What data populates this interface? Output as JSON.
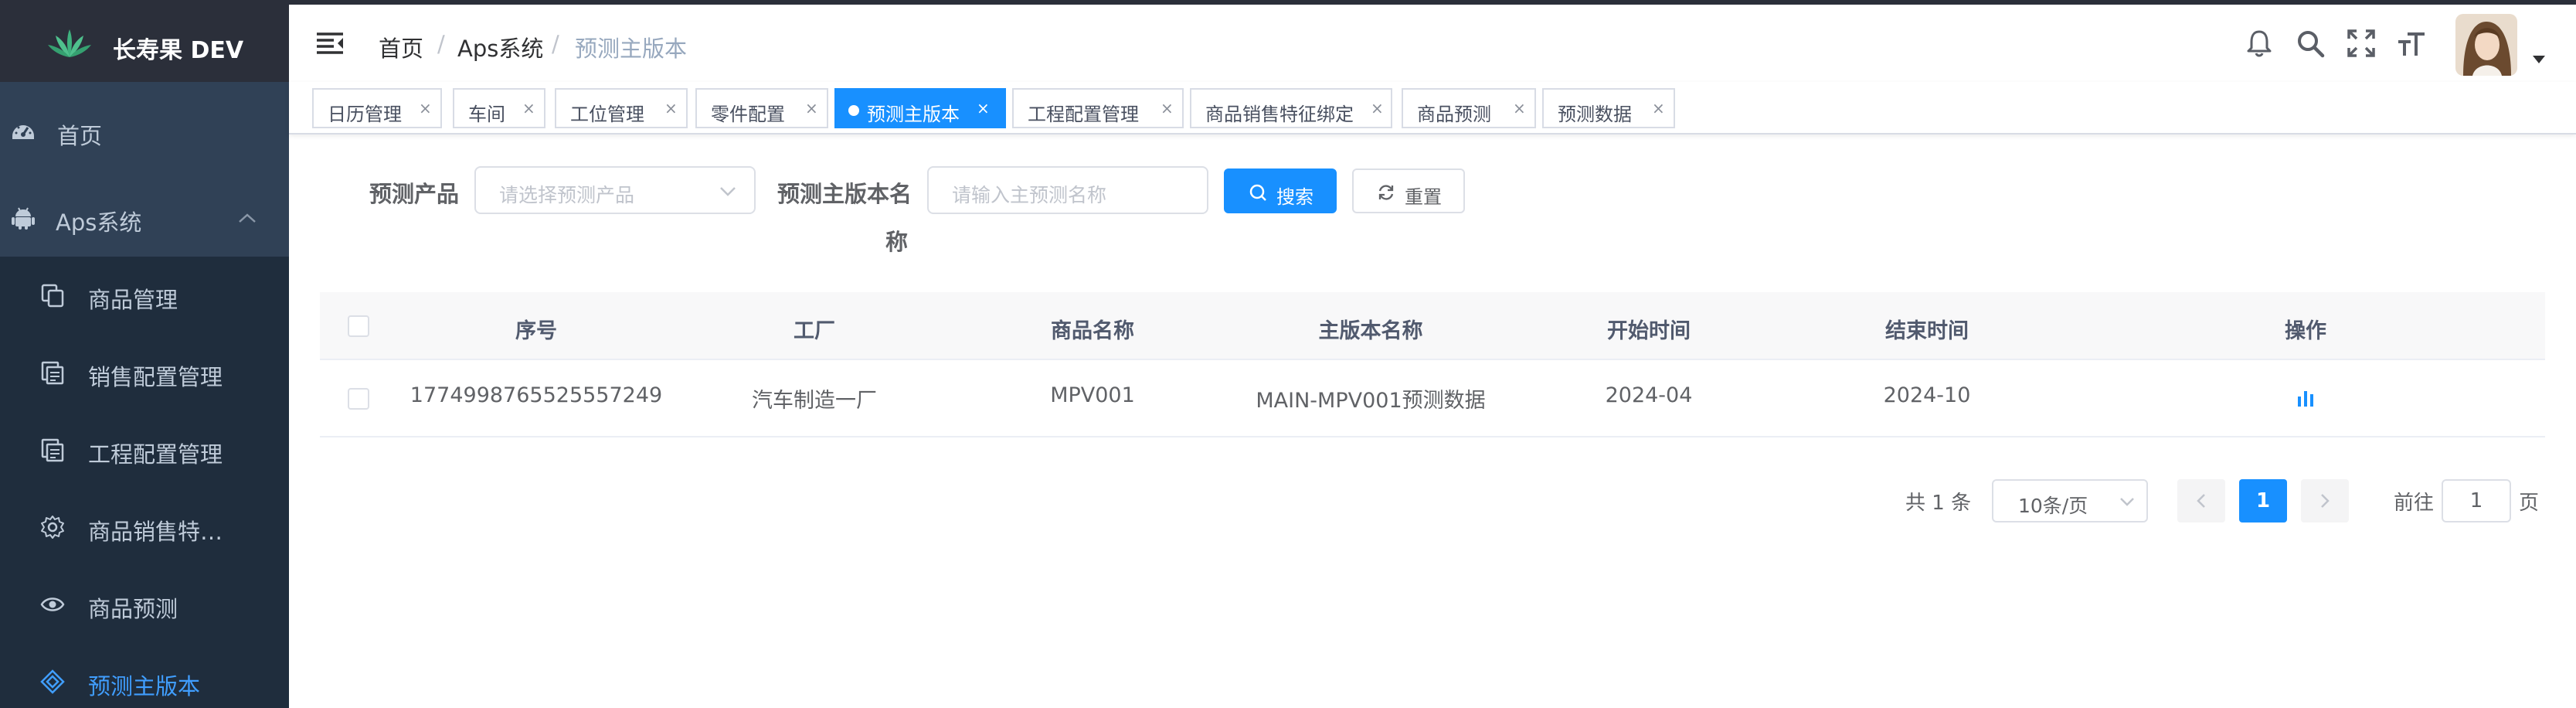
{
  "colors": {
    "sidebar_bg": "#304156",
    "logo_bg": "#2b2f3a",
    "accent": "#1890ff",
    "menu_text": "#bfcbd9",
    "menu_active": "#409eff"
  },
  "sidebar": {
    "logo_text": "长寿果 DEV",
    "items": [
      {
        "label": "首页",
        "icon": "dashboard-icon"
      },
      {
        "label": "Aps系统",
        "icon": "android-icon",
        "expanded": true
      },
      {
        "label": "商品管理",
        "icon": "copy-icon"
      },
      {
        "label": "销售配置管理",
        "icon": "document-copy-icon"
      },
      {
        "label": "工程配置管理",
        "icon": "document-copy-icon"
      },
      {
        "label": "商品销售特…",
        "icon": "gear-icon"
      },
      {
        "label": "商品预测",
        "icon": "eye-icon"
      },
      {
        "label": "预测主版本",
        "icon": "diamond-icon",
        "active": true
      }
    ]
  },
  "header": {
    "breadcrumb": [
      "首页",
      "Aps系统",
      "预测主版本"
    ],
    "breadcrumb_sep": "/",
    "icons": [
      "bell-icon",
      "search-icon",
      "fullscreen-icon",
      "font-size-icon",
      "avatar",
      "caret-down-icon"
    ]
  },
  "tabs": [
    {
      "label": "日历管理",
      "close": "×"
    },
    {
      "label": "车间",
      "close": "×"
    },
    {
      "label": "工位管理",
      "close": "×"
    },
    {
      "label": "零件配置",
      "close": "×"
    },
    {
      "label": "预测主版本",
      "close": "×",
      "active": true
    },
    {
      "label": "工程配置管理",
      "close": "×"
    },
    {
      "label": "商品销售特征绑定",
      "close": "×"
    },
    {
      "label": "商品预测",
      "close": "×"
    },
    {
      "label": "预测数据",
      "close": "×"
    }
  ],
  "search": {
    "product_label": "预测产品",
    "product_placeholder": "请选择预测产品",
    "name_label_line1": "预测主版本名",
    "name_label_line2": "称",
    "name_placeholder": "请输入主预测名称",
    "search_button": "搜索",
    "reset_button": "重置"
  },
  "table": {
    "columns": [
      "序号",
      "工厂",
      "商品名称",
      "主版本名称",
      "开始时间",
      "结束时间",
      "操作"
    ],
    "rows": [
      {
        "id": "1774998765525557249",
        "factory": "汽车制造一厂",
        "product": "MPV001",
        "version_name": "MAIN-MPV001预测数据",
        "start": "2024-04",
        "end": "2024-10",
        "action_icon": "bar-chart-icon"
      }
    ]
  },
  "pagination": {
    "total_text": "共 1 条",
    "page_size": "10条/页",
    "current_page": "1",
    "goto_label": "前往",
    "goto_value": "1",
    "page_unit": "页"
  }
}
